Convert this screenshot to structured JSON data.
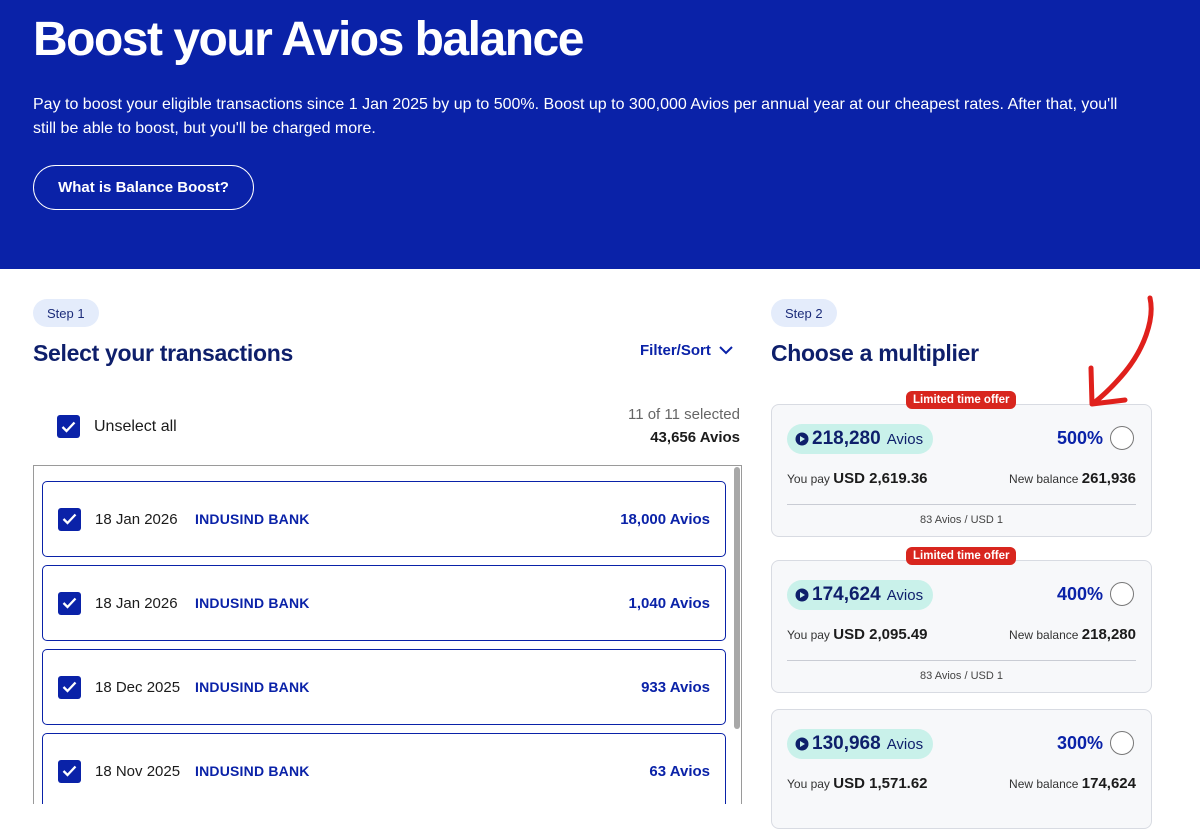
{
  "hero": {
    "title": "Boost your Avios balance",
    "description": "Pay to boost your eligible transactions since 1 Jan 2025 by up to 500%. Boost up to 300,000 Avios per annual year at our cheapest rates. After that, you'll still be able to boost, but you'll be charged more.",
    "button_label": "What is Balance Boost?"
  },
  "step1": {
    "pill": "Step 1",
    "title": "Select your transactions",
    "filter_label": "Filter/Sort",
    "unselect_label": "Unselect all",
    "selected_count": "11 of 11 selected",
    "selected_total": "43,656 Avios",
    "transactions": [
      {
        "date": "18 Jan 2026",
        "bank": "INDUSIND BANK",
        "avios": "18,000 Avios",
        "checked": true
      },
      {
        "date": "18 Jan 2026",
        "bank": "INDUSIND BANK",
        "avios": "1,040 Avios",
        "checked": true
      },
      {
        "date": "18 Dec 2025",
        "bank": "INDUSIND BANK",
        "avios": "933 Avios",
        "checked": true
      },
      {
        "date": "18 Nov 2025",
        "bank": "INDUSIND BANK",
        "avios": "63 Avios",
        "checked": true
      }
    ]
  },
  "step2": {
    "pill": "Step 2",
    "title": "Choose a multiplier",
    "options": [
      {
        "badge": "Limited time offer",
        "avios": "218,280",
        "avios_unit": "Avios",
        "percent": "500%",
        "pay_label": "You pay",
        "pay_amount": "USD 2,619.36",
        "balance_label": "New balance",
        "balance": "261,936",
        "rate": "83 Avios / USD 1"
      },
      {
        "badge": "Limited time offer",
        "avios": "174,624",
        "avios_unit": "Avios",
        "percent": "400%",
        "pay_label": "You pay",
        "pay_amount": "USD 2,095.49",
        "balance_label": "New balance",
        "balance": "218,280",
        "rate": "83 Avios / USD 1"
      },
      {
        "badge": "",
        "avios": "130,968",
        "avios_unit": "Avios",
        "percent": "300%",
        "pay_label": "You pay",
        "pay_amount": "USD 1,571.62",
        "balance_label": "New balance",
        "balance": "174,624",
        "rate": ""
      }
    ]
  },
  "colors": {
    "brand_blue": "#0a22a8",
    "offer_red": "#d8261e",
    "avios_pill": "#c9f1ea",
    "annotation_arrow": "#e0201c"
  },
  "icons": [
    "checkbox-checked-icon",
    "chevron-down-icon",
    "play-icon",
    "radio-icon",
    "annotation-arrow-icon"
  ]
}
